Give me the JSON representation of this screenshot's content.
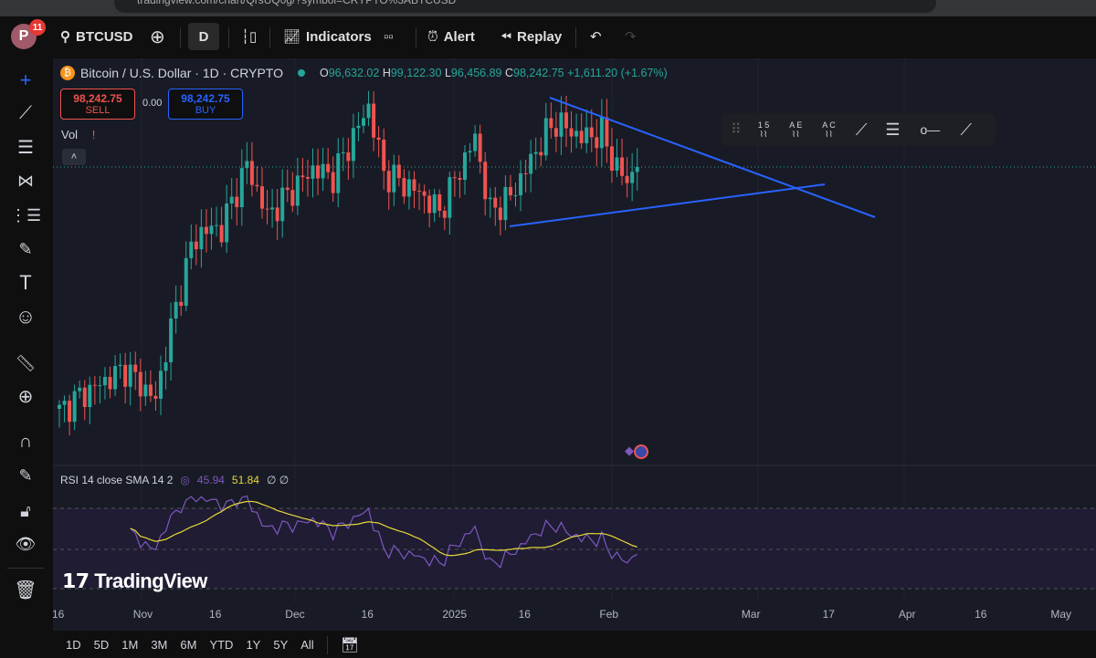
{
  "browser": {
    "url": "tradingview.com/chart/QrsUQ0g/?symbol=CRYPTO%3ABTCUSD"
  },
  "topbar": {
    "avatar": "P",
    "notifications": "11",
    "symbol": "BTCUSD",
    "interval": "D",
    "indicators": "Indicators",
    "alert": "Alert",
    "replay": "Replay"
  },
  "legend": {
    "title": "Bitcoin / U.S. Dollar · 1D · CRYPTO",
    "o_label": "O",
    "o": "96,632.02",
    "h_label": "H",
    "h": "99,122.30",
    "l_label": "L",
    "l": "96,456.89",
    "c_label": "C",
    "c": "98,242.75",
    "change": "+1,611.20 (+1.67%)"
  },
  "trade": {
    "sell_price": "98,242.75",
    "sell": "SELL",
    "spread": "0.00",
    "buy_price": "98,242.75",
    "buy": "BUY"
  },
  "vol": {
    "label": "Vol"
  },
  "rsi": {
    "label": "RSI 14 close SMA 14 2",
    "rsi": "45.94",
    "sma": "51.84",
    "extra": "∅ ∅"
  },
  "watermark": "TradingView",
  "drawing_toolbar": {
    "labels": [
      "1 5",
      "A E",
      "A C"
    ]
  },
  "xaxis": [
    {
      "t": "16",
      "d": 0
    },
    {
      "t": "Nov",
      "d": 16
    },
    {
      "t": "16",
      "d": 31
    },
    {
      "t": "Dec",
      "d": 46
    },
    {
      "t": "16",
      "d": 61
    },
    {
      "t": "2025",
      "d": 77
    },
    {
      "t": "16",
      "d": 92
    },
    {
      "t": "Feb",
      "d": 108
    },
    {
      "t": "Mar",
      "d": 136
    },
    {
      "t": "17",
      "d": 152
    },
    {
      "t": "Apr",
      "d": 167
    },
    {
      "t": "16",
      "d": 182
    },
    {
      "t": "May",
      "d": 197
    }
  ],
  "ranges": [
    "1D",
    "5D",
    "1M",
    "3M",
    "6M",
    "YTD",
    "1Y",
    "5Y",
    "All"
  ],
  "colors": {
    "up": "#26a69a",
    "down": "#ef5350",
    "trend": "#2962ff",
    "rsi": "#7e57c2",
    "sma": "#e6d83a"
  },
  "chart_data": {
    "type": "candlestick",
    "start": "Oct 16 2024",
    "interval": "1D",
    "keypoints": [
      [
        0,
        67000
      ],
      [
        4,
        69000
      ],
      [
        13,
        72500
      ],
      [
        19,
        68500
      ],
      [
        21,
        75000
      ],
      [
        26,
        88000
      ],
      [
        28,
        90000
      ],
      [
        32,
        90500
      ],
      [
        37,
        98500
      ],
      [
        41,
        92000
      ],
      [
        50,
        98000
      ],
      [
        54,
        97000
      ],
      [
        61,
        106000
      ],
      [
        64,
        97500
      ],
      [
        71,
        95000
      ],
      [
        75,
        92500
      ],
      [
        82,
        102000
      ],
      [
        85,
        92500
      ],
      [
        89,
        94500
      ],
      [
        96,
        102500
      ],
      [
        98,
        104000
      ],
      [
        103,
        102000
      ],
      [
        107,
        102500
      ],
      [
        110,
        98000
      ],
      [
        112,
        96500
      ],
      [
        114,
        98242.75
      ]
    ]
  }
}
